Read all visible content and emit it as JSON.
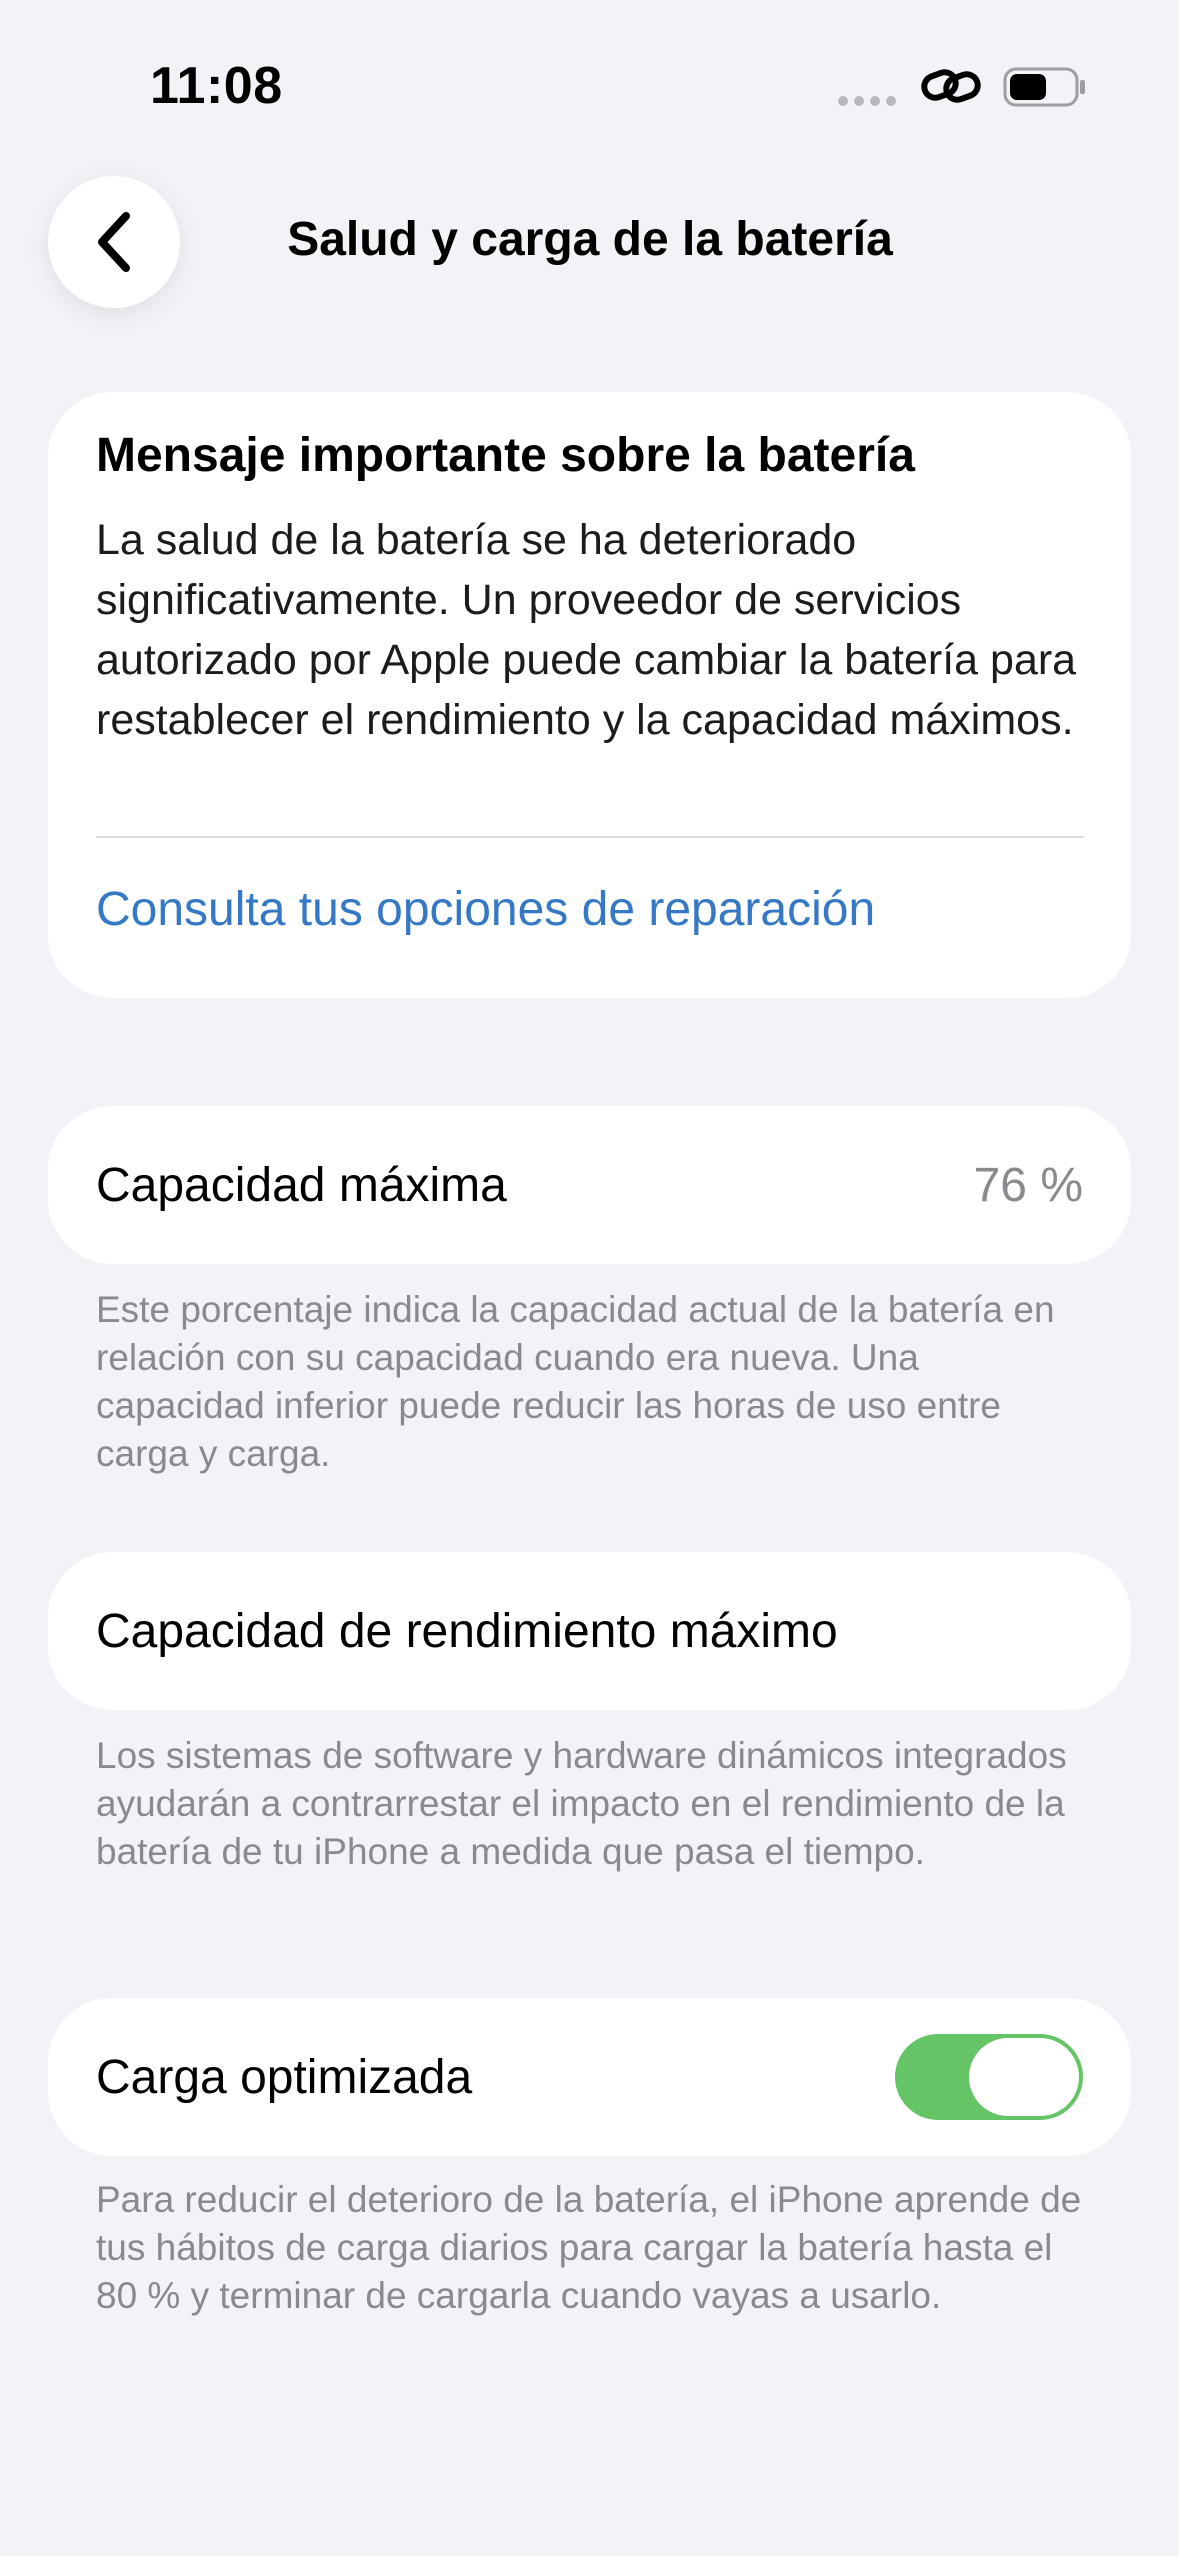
{
  "status_bar": {
    "time": "11:08"
  },
  "nav": {
    "back_icon": "chevron-left-icon",
    "title": "Salud y carga de la batería"
  },
  "battery_message": {
    "title": "Mensaje importante sobre la batería",
    "body": "La salud de la batería se ha deteriorado significativamente. Un proveedor de servicios autorizado por Apple puede cambiar la batería para restablecer el rendimiento y la capacidad máximos.",
    "link": "Consulta tus opciones de reparación",
    "link_color": "#3478c6"
  },
  "max_capacity": {
    "label": "Capacidad máxima",
    "value": "76 %",
    "footnote": "Este porcentaje indica la capacidad actual de la batería en relación con su capacidad cuando era nueva. Una capacidad inferior puede reducir las horas de uso entre carga y carga."
  },
  "peak_performance": {
    "label": "Capacidad de rendimiento máximo",
    "footnote": "Los sistemas de software y hardware dinámicos integrados ayudarán a contrarrestar el impacto en el rendimiento de la batería de tu iPhone a medida que pasa el tiempo."
  },
  "optimized_charging": {
    "label": "Carga optimizada",
    "enabled": true,
    "toggle_color": "#65c466",
    "footnote": "Para reducir el deterioro de la batería, el iPhone aprende de tus hábitos de carga diarios para cargar la batería hasta el 80 % y terminar de cargarla cuando vayas a usarlo."
  }
}
